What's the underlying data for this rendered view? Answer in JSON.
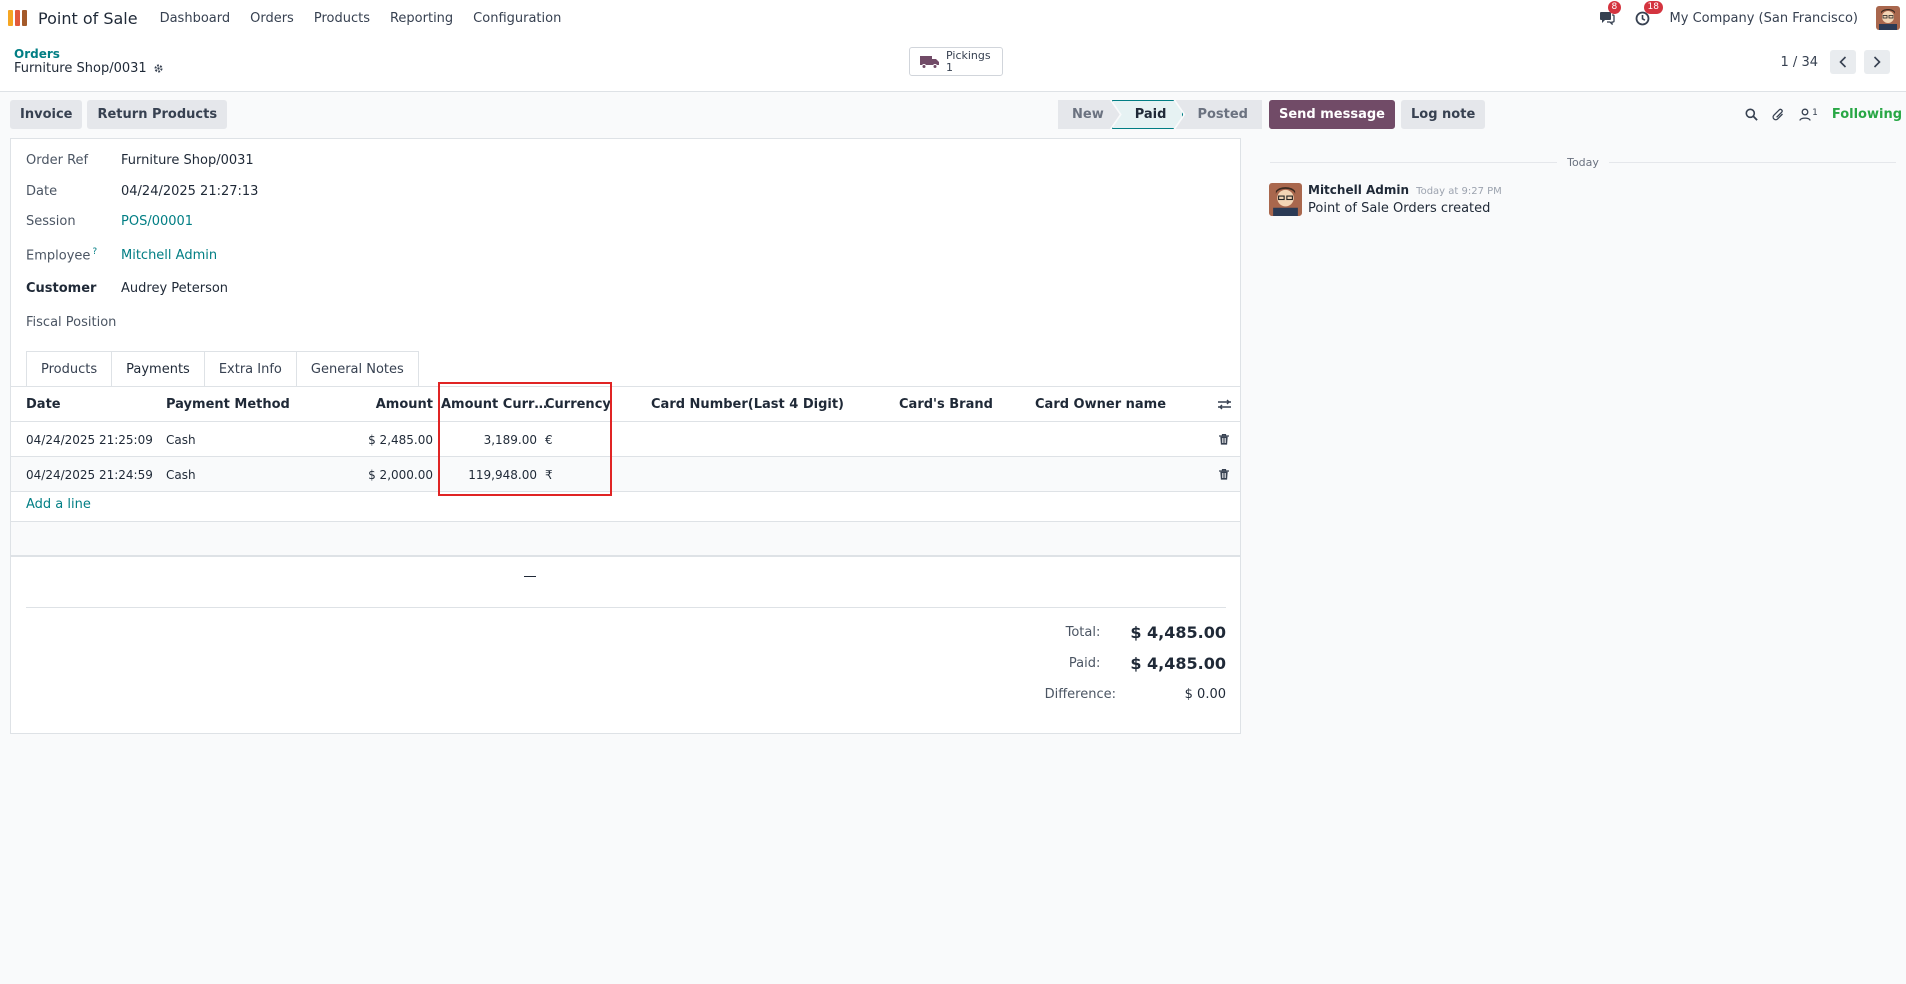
{
  "topbar": {
    "app_name": "Point of Sale",
    "menu": [
      "Dashboard",
      "Orders",
      "Products",
      "Reporting",
      "Configuration"
    ],
    "messages_count": "8",
    "activities_count": "18",
    "company": "My Company (San Francisco)"
  },
  "breadcrumb": {
    "parent": "Orders",
    "current": "Furniture Shop/0031"
  },
  "smart_button": {
    "label": "Pickings",
    "count": "1"
  },
  "pager": {
    "value": "1 / 34"
  },
  "actions": {
    "invoice": "Invoice",
    "return_products": "Return Products"
  },
  "status": {
    "new": "New",
    "paid": "Paid",
    "posted": "Posted",
    "active": "Paid"
  },
  "fields": {
    "order_ref_label": "Order Ref",
    "order_ref": "Furniture Shop/0031",
    "date_label": "Date",
    "date": "04/24/2025 21:27:13",
    "session_label": "Session",
    "session": "POS/00001",
    "employee_label": "Employee",
    "employee_help": "?",
    "employee": "Mitchell Admin",
    "customer_label": "Customer",
    "customer": "Audrey Peterson",
    "fiscal_label": "Fiscal Position"
  },
  "tabs": [
    "Products",
    "Payments",
    "Extra Info",
    "General Notes"
  ],
  "active_tab": "Payments",
  "payments": {
    "headers": {
      "date": "Date",
      "method": "Payment Method",
      "amount": "Amount",
      "amount_currency": "Amount Curr…",
      "currency": "Currency",
      "card_number": "Card Number(Last 4 Digit)",
      "card_brand": "Card's Brand",
      "card_owner": "Card Owner name"
    },
    "rows": [
      {
        "date": "04/24/2025 21:25:09",
        "method": "Cash",
        "amount": "$ 2,485.00",
        "amount_currency": "3,189.00",
        "currency": "€"
      },
      {
        "date": "04/24/2025 21:24:59",
        "method": "Cash",
        "amount": "$ 2,000.00",
        "amount_currency": "119,948.00",
        "currency": "₹"
      }
    ],
    "add_line": "Add a line"
  },
  "totals": {
    "total_label": "Total:",
    "total": "$ 4,485.00",
    "paid_label": "Paid:",
    "paid": "$ 4,485.00",
    "difference_label": "Difference:",
    "difference": "$ 0.00"
  },
  "chatter": {
    "send_message": "Send message",
    "log_note": "Log note",
    "followers_count": "1",
    "following": "Following",
    "date_separator": "Today",
    "message": {
      "author": "Mitchell Admin",
      "time": "Today at 9:27 PM",
      "body": "Point of Sale Orders created"
    }
  },
  "colors": {
    "brand": "#714b67",
    "link": "#017e84",
    "badge": "#d4343f",
    "highlight": "#e02424",
    "following": "#28a745"
  }
}
